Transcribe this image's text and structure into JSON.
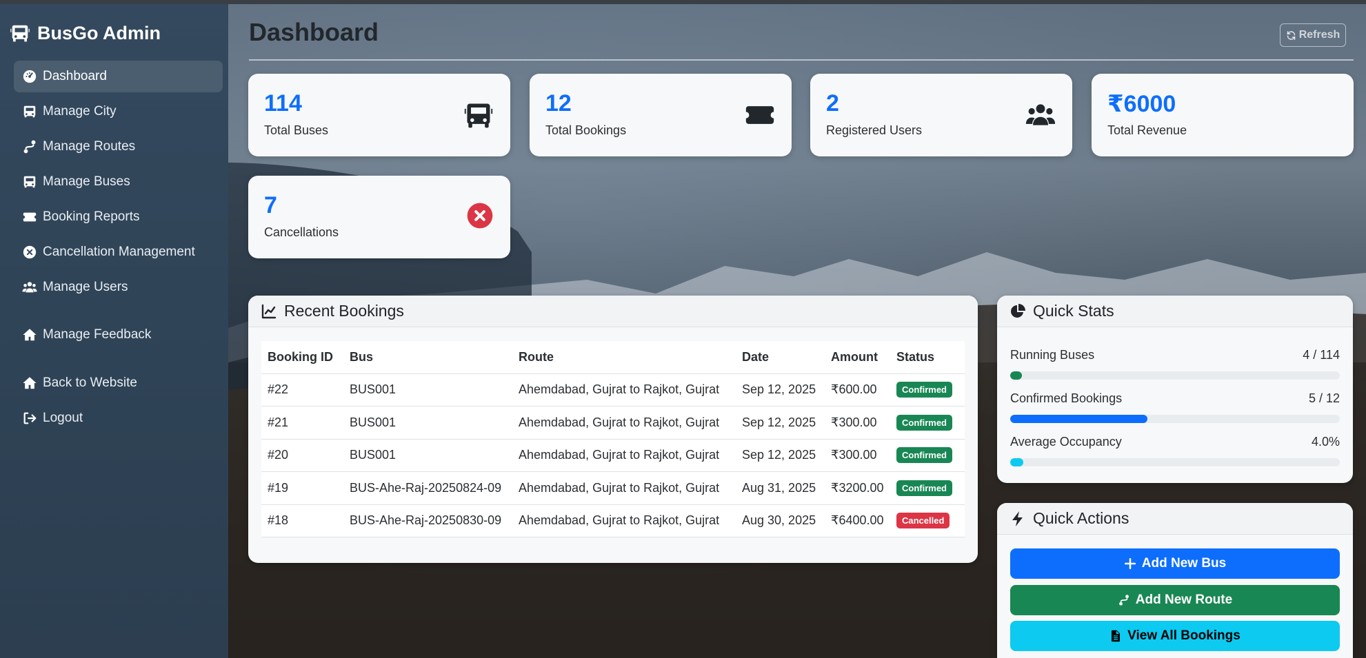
{
  "brand": {
    "title": "BusGo Admin"
  },
  "sidebar": {
    "items": [
      {
        "label": "Dashboard",
        "icon": "dashboard-icon",
        "active": true
      },
      {
        "label": "Manage City",
        "icon": "bus-icon"
      },
      {
        "label": "Manage Routes",
        "icon": "route-icon"
      },
      {
        "label": "Manage Buses",
        "icon": "bus-icon"
      },
      {
        "label": "Booking Reports",
        "icon": "ticket-icon"
      },
      {
        "label": "Cancellation Management",
        "icon": "x-circle-icon"
      },
      {
        "label": "Manage Users",
        "icon": "users-icon"
      },
      {
        "label": "Manage Feedback",
        "icon": "home-icon"
      },
      {
        "label": "Back to Website",
        "icon": "home-icon"
      },
      {
        "label": "Logout",
        "icon": "logout-icon"
      }
    ]
  },
  "header": {
    "title": "Dashboard",
    "refresh_label": "Refresh"
  },
  "stats": [
    {
      "value": "114",
      "label": "Total Buses",
      "icon": "bus-icon"
    },
    {
      "value": "12",
      "label": "Total Bookings",
      "icon": "ticket-icon"
    },
    {
      "value": "2",
      "label": "Registered Users",
      "icon": "users-icon"
    },
    {
      "value": "₹6000",
      "label": "Total Revenue"
    },
    {
      "value": "7",
      "label": "Cancellations",
      "icon": "x-circle-icon"
    }
  ],
  "recent_bookings": {
    "title": "Recent Bookings",
    "columns": [
      "Booking ID",
      "Bus",
      "Route",
      "Date",
      "Amount",
      "Status"
    ],
    "rows": [
      {
        "id": "#22",
        "bus": "BUS001",
        "route": "Ahemdabad, Gujrat to Rajkot, Gujrat",
        "date": "Sep 12, 2025",
        "amount": "₹600.00",
        "status": "Confirmed"
      },
      {
        "id": "#21",
        "bus": "BUS001",
        "route": "Ahemdabad, Gujrat to Rajkot, Gujrat",
        "date": "Sep 12, 2025",
        "amount": "₹300.00",
        "status": "Confirmed"
      },
      {
        "id": "#20",
        "bus": "BUS001",
        "route": "Ahemdabad, Gujrat to Rajkot, Gujrat",
        "date": "Sep 12, 2025",
        "amount": "₹300.00",
        "status": "Confirmed"
      },
      {
        "id": "#19",
        "bus": "BUS-Ahe-Raj-20250824-09",
        "route": "Ahemdabad, Gujrat to Rajkot, Gujrat",
        "date": "Aug 31, 2025",
        "amount": "₹3200.00",
        "status": "Confirmed"
      },
      {
        "id": "#18",
        "bus": "BUS-Ahe-Raj-20250830-09",
        "route": "Ahemdabad, Gujrat to Rajkot, Gujrat",
        "date": "Aug 30, 2025",
        "amount": "₹6400.00",
        "status": "Cancelled"
      }
    ]
  },
  "quick_stats": {
    "title": "Quick Stats",
    "items": [
      {
        "label": "Running Buses",
        "value": "4 / 114",
        "fraction": 0.035,
        "color": "#198754"
      },
      {
        "label": "Confirmed Bookings",
        "value": "5 / 12",
        "fraction": 0.417,
        "color": "#0d6efd"
      },
      {
        "label": "Average Occupancy",
        "value": "4.0%",
        "fraction": 0.04,
        "color": "#0dcaf0"
      }
    ]
  },
  "quick_actions": {
    "title": "Quick Actions",
    "buttons": [
      {
        "label": "Add New Bus",
        "icon": "plus-icon",
        "color": "#0d6efd"
      },
      {
        "label": "Add New Route",
        "icon": "route-icon",
        "color": "#198754"
      },
      {
        "label": "View All Bookings",
        "icon": "file-icon",
        "color": "#0dcaf0",
        "text_color": "#000000"
      }
    ]
  },
  "colors": {
    "accent": "#0d6efd",
    "confirmed": "#198754",
    "cancelled": "#dc3545",
    "sidebar": "#34495e"
  }
}
